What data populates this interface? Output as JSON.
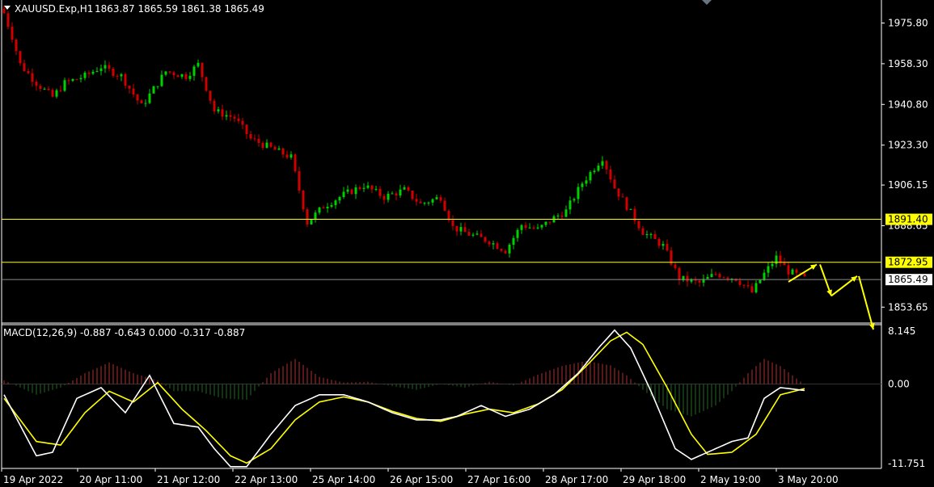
{
  "window": {
    "symbol_header": "XAUUSD.Exp,H1",
    "ohlc": "1863.87 1865.59 1861.38 1865.49"
  },
  "price_axis": {
    "ticks": [
      "1975.80",
      "1958.30",
      "1940.80",
      "1923.30",
      "1906.15",
      "1888.65",
      "1853.65"
    ],
    "current_price_label": "1865.49",
    "level_labels": [
      "1891.40",
      "1872.95"
    ]
  },
  "macd": {
    "title": "MACD(12,26,9) -0.887 -0.643 0.000 -0.317 -0.887",
    "ticks": [
      "8.145",
      "0.00",
      "-11.751"
    ]
  },
  "time_axis": {
    "labels": [
      "19 Apr 2022",
      "20 Apr 11:00",
      "21 Apr 12:00",
      "22 Apr 13:00",
      "25 Apr 14:00",
      "26 Apr 15:00",
      "27 Apr 16:00",
      "28 Apr 17:00",
      "29 Apr 18:00",
      "2 May 19:00",
      "3 May 20:00"
    ]
  },
  "colors": {
    "background": "#000000",
    "bull": "#00d000",
    "bear": "#d00000",
    "level_line": "#ffff00",
    "signal": "#ffff00",
    "macd_line": "#ffffff",
    "hist_pos": "#b03030",
    "hist_neg": "#1f6a1f"
  },
  "chart_data": {
    "type": "candlestick",
    "price_ylim": [
      1846.8,
      1985.0
    ],
    "horizontal_levels": [
      1891.4,
      1872.95
    ],
    "current_price": 1865.49,
    "candle_path": [
      [
        0,
        1980
      ],
      [
        2,
        1970
      ],
      [
        4,
        1958
      ],
      [
        8,
        1950
      ],
      [
        12,
        1944
      ],
      [
        15,
        1950
      ],
      [
        20,
        1953
      ],
      [
        24,
        1957
      ],
      [
        29,
        1953
      ],
      [
        34,
        1940
      ],
      [
        40,
        1955
      ],
      [
        45,
        1953
      ],
      [
        48,
        1958
      ],
      [
        52,
        1938
      ],
      [
        57,
        1935
      ],
      [
        61,
        1926
      ],
      [
        66,
        1922
      ],
      [
        71,
        1918
      ],
      [
        75,
        1890
      ],
      [
        79,
        1897
      ],
      [
        84,
        1902
      ],
      [
        89,
        1906
      ],
      [
        94,
        1901
      ],
      [
        99,
        1904
      ],
      [
        103,
        1898
      ],
      [
        108,
        1901
      ],
      [
        111,
        1888
      ],
      [
        115,
        1885
      ],
      [
        120,
        1882
      ],
      [
        124,
        1878
      ],
      [
        128,
        1889
      ],
      [
        132,
        1887
      ],
      [
        136,
        1892
      ],
      [
        139,
        1895
      ],
      [
        143,
        1907
      ],
      [
        148,
        1918
      ],
      [
        151,
        1905
      ],
      [
        154,
        1897
      ],
      [
        158,
        1886
      ],
      [
        163,
        1880
      ],
      [
        167,
        1866
      ],
      [
        172,
        1864
      ],
      [
        176,
        1868
      ],
      [
        181,
        1866
      ],
      [
        185,
        1860
      ],
      [
        188,
        1868
      ],
      [
        191,
        1875
      ],
      [
        194,
        1869
      ],
      [
        198,
        1866
      ]
    ],
    "projection_arrows": [
      [
        1864.5,
        1872.0
      ],
      [
        1872.0,
        1858.5
      ],
      [
        1858.5,
        1867.0
      ],
      [
        1867.0,
        1844.0
      ]
    ],
    "macd_ylim": [
      -11.751,
      8.145
    ],
    "macd_line": [
      [
        0,
        -1.5
      ],
      [
        8,
        -10
      ],
      [
        12,
        -9.5
      ],
      [
        18,
        -2
      ],
      [
        24,
        -0.5
      ],
      [
        30,
        -4
      ],
      [
        36,
        1.2
      ],
      [
        42,
        -5.5
      ],
      [
        48,
        -6
      ],
      [
        52,
        -9
      ],
      [
        56,
        -11.5
      ],
      [
        60,
        -11.5
      ],
      [
        66,
        -7
      ],
      [
        72,
        -3
      ],
      [
        78,
        -1.5
      ],
      [
        84,
        -1.5
      ],
      [
        90,
        -2.5
      ],
      [
        96,
        -4
      ],
      [
        102,
        -5
      ],
      [
        108,
        -5
      ],
      [
        112,
        -4.5
      ],
      [
        118,
        -3
      ],
      [
        124,
        -4.5
      ],
      [
        130,
        -3.5
      ],
      [
        136,
        -1.5
      ],
      [
        142,
        1.5
      ],
      [
        147,
        5
      ],
      [
        151,
        7.5
      ],
      [
        155,
        5
      ],
      [
        160,
        -1
      ],
      [
        166,
        -9
      ],
      [
        170,
        -10.5
      ],
      [
        176,
        -9
      ],
      [
        180,
        -8
      ],
      [
        184,
        -7.5
      ],
      [
        188,
        -2
      ],
      [
        192,
        -0.5
      ],
      [
        198,
        -0.9
      ]
    ],
    "signal_line": [
      [
        0,
        -2
      ],
      [
        8,
        -8
      ],
      [
        14,
        -8.5
      ],
      [
        20,
        -4
      ],
      [
        26,
        -1
      ],
      [
        32,
        -2.5
      ],
      [
        38,
        0.2
      ],
      [
        44,
        -3.5
      ],
      [
        50,
        -6.5
      ],
      [
        56,
        -10
      ],
      [
        60,
        -11
      ],
      [
        66,
        -9
      ],
      [
        72,
        -5
      ],
      [
        78,
        -2.5
      ],
      [
        84,
        -1.8
      ],
      [
        90,
        -2.5
      ],
      [
        96,
        -3.8
      ],
      [
        102,
        -4.8
      ],
      [
        108,
        -5.2
      ],
      [
        114,
        -4.2
      ],
      [
        120,
        -3.5
      ],
      [
        126,
        -4
      ],
      [
        132,
        -2.8
      ],
      [
        138,
        -0.8
      ],
      [
        144,
        2.5
      ],
      [
        150,
        6
      ],
      [
        154,
        7.2
      ],
      [
        158,
        5.5
      ],
      [
        164,
        -0.5
      ],
      [
        170,
        -7
      ],
      [
        174,
        -9.8
      ],
      [
        180,
        -9.5
      ],
      [
        186,
        -7
      ],
      [
        192,
        -1.5
      ],
      [
        198,
        -0.64
      ]
    ],
    "histogram": [
      [
        0,
        0.5
      ],
      [
        8,
        -1.5
      ],
      [
        14,
        -0.5
      ],
      [
        20,
        1.5
      ],
      [
        26,
        3
      ],
      [
        32,
        1.5
      ],
      [
        38,
        0.5
      ],
      [
        42,
        -1
      ],
      [
        48,
        -1
      ],
      [
        54,
        -2
      ],
      [
        60,
        -2.2
      ],
      [
        66,
        1.5
      ],
      [
        72,
        3.5
      ],
      [
        78,
        1
      ],
      [
        84,
        0.2
      ],
      [
        90,
        0.3
      ],
      [
        96,
        -0.3
      ],
      [
        102,
        -0.8
      ],
      [
        108,
        0
      ],
      [
        114,
        -0.5
      ],
      [
        120,
        0.3
      ],
      [
        126,
        -0.2
      ],
      [
        132,
        1.3
      ],
      [
        138,
        2.5
      ],
      [
        144,
        3.2
      ],
      [
        150,
        2.6
      ],
      [
        154,
        1.2
      ],
      [
        158,
        -0.8
      ],
      [
        164,
        -3.5
      ],
      [
        170,
        -4.5
      ],
      [
        176,
        -3
      ],
      [
        180,
        -1
      ],
      [
        184,
        1.5
      ],
      [
        188,
        3.5
      ],
      [
        192,
        2.5
      ],
      [
        198,
        -0.1
      ]
    ]
  }
}
